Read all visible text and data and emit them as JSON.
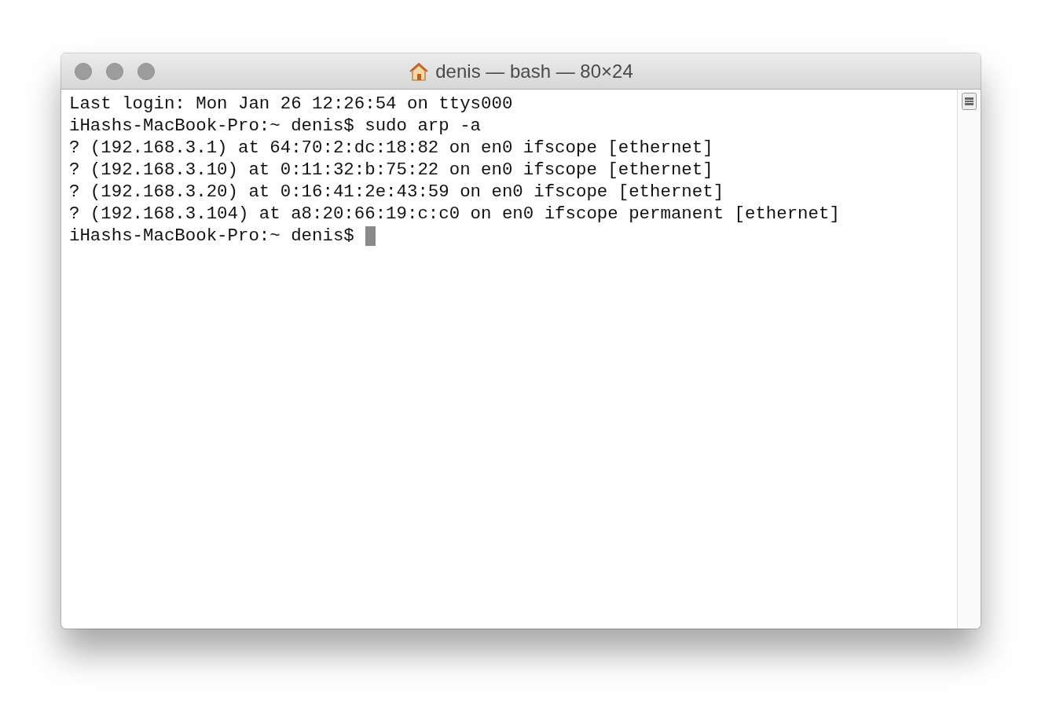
{
  "window": {
    "title": "denis — bash — 80×24"
  },
  "terminal": {
    "lines": [
      "Last login: Mon Jan 26 12:26:54 on ttys000",
      "iHashs-MacBook-Pro:~ denis$ sudo arp -a",
      "? (192.168.3.1) at 64:70:2:dc:18:82 on en0 ifscope [ethernet]",
      "? (192.168.3.10) at 0:11:32:b:75:22 on en0 ifscope [ethernet]",
      "? (192.168.3.20) at 0:16:41:2e:43:59 on en0 ifscope [ethernet]",
      "? (192.168.3.104) at a8:20:66:19:c:c0 on en0 ifscope permanent [ethernet]"
    ],
    "prompt": {
      "text": "iHashs-MacBook-Pro:~ denis$",
      "cursor": true
    }
  }
}
